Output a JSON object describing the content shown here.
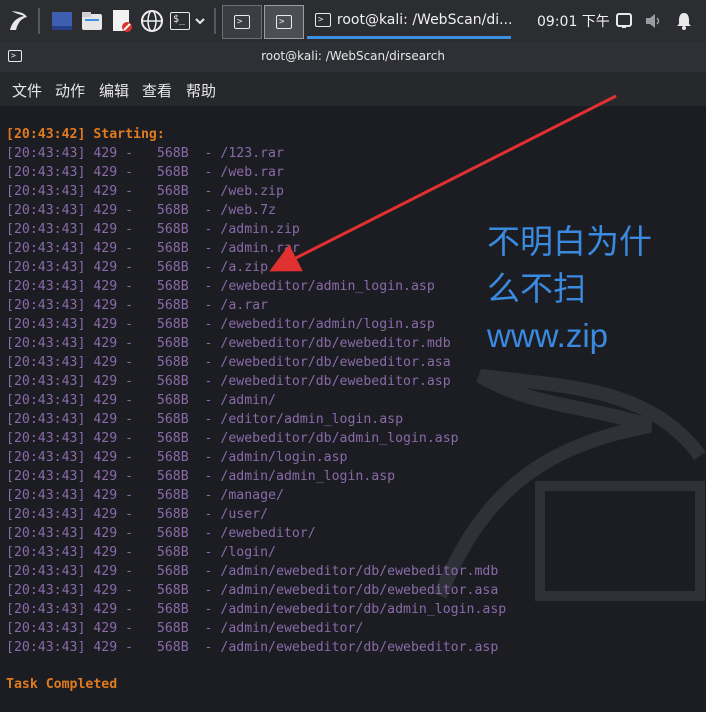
{
  "taskbar": {
    "window_title": "root@kali: /WebScan/di...",
    "clock": "09:01 下午",
    "icons": [
      "kali-dragon-icon",
      "show-desktop-icon",
      "file-manager-icon",
      "text-editor-icon",
      "web-browser-icon",
      "terminal-icon",
      "chevron-down-icon",
      "workspace-1-icon",
      "workspace-2-icon",
      "window-terminal-icon",
      "display-icon",
      "volume-icon",
      "notification-bell-icon"
    ]
  },
  "terminal": {
    "title": "root@kali: /WebScan/dirsearch",
    "menu": [
      "文件",
      "动作",
      "编辑",
      "查看",
      "帮助"
    ],
    "start_line": "[20:43:42] Starting:",
    "rows": [
      {
        "time": "[20:43:43]",
        "code": "429",
        "size": "568B",
        "path": "/123.rar"
      },
      {
        "time": "[20:43:43]",
        "code": "429",
        "size": "568B",
        "path": "/web.rar"
      },
      {
        "time": "[20:43:43]",
        "code": "429",
        "size": "568B",
        "path": "/web.zip"
      },
      {
        "time": "[20:43:43]",
        "code": "429",
        "size": "568B",
        "path": "/web.7z"
      },
      {
        "time": "[20:43:43]",
        "code": "429",
        "size": "568B",
        "path": "/admin.zip"
      },
      {
        "time": "[20:43:43]",
        "code": "429",
        "size": "568B",
        "path": "/admin.rar"
      },
      {
        "time": "[20:43:43]",
        "code": "429",
        "size": "568B",
        "path": "/a.zip"
      },
      {
        "time": "[20:43:43]",
        "code": "429",
        "size": "568B",
        "path": "/ewebeditor/admin_login.asp"
      },
      {
        "time": "[20:43:43]",
        "code": "429",
        "size": "568B",
        "path": "/a.rar"
      },
      {
        "time": "[20:43:43]",
        "code": "429",
        "size": "568B",
        "path": "/ewebeditor/admin/login.asp"
      },
      {
        "time": "[20:43:43]",
        "code": "429",
        "size": "568B",
        "path": "/ewebeditor/db/ewebeditor.mdb"
      },
      {
        "time": "[20:43:43]",
        "code": "429",
        "size": "568B",
        "path": "/ewebeditor/db/ewebeditor.asa"
      },
      {
        "time": "[20:43:43]",
        "code": "429",
        "size": "568B",
        "path": "/ewebeditor/db/ewebeditor.asp"
      },
      {
        "time": "[20:43:43]",
        "code": "429",
        "size": "568B",
        "path": "/admin/"
      },
      {
        "time": "[20:43:43]",
        "code": "429",
        "size": "568B",
        "path": "/editor/admin_login.asp"
      },
      {
        "time": "[20:43:43]",
        "code": "429",
        "size": "568B",
        "path": "/ewebeditor/db/admin_login.asp"
      },
      {
        "time": "[20:43:43]",
        "code": "429",
        "size": "568B",
        "path": "/admin/login.asp"
      },
      {
        "time": "[20:43:43]",
        "code": "429",
        "size": "568B",
        "path": "/admin/admin_login.asp"
      },
      {
        "time": "[20:43:43]",
        "code": "429",
        "size": "568B",
        "path": "/manage/"
      },
      {
        "time": "[20:43:43]",
        "code": "429",
        "size": "568B",
        "path": "/user/"
      },
      {
        "time": "[20:43:43]",
        "code": "429",
        "size": "568B",
        "path": "/ewebeditor/"
      },
      {
        "time": "[20:43:43]",
        "code": "429",
        "size": "568B",
        "path": "/login/"
      },
      {
        "time": "[20:43:43]",
        "code": "429",
        "size": "568B",
        "path": "/admin/ewebeditor/db/ewebeditor.mdb"
      },
      {
        "time": "[20:43:43]",
        "code": "429",
        "size": "568B",
        "path": "/admin/ewebeditor/db/ewebeditor.asa"
      },
      {
        "time": "[20:43:43]",
        "code": "429",
        "size": "568B",
        "path": "/admin/ewebeditor/db/admin_login.asp"
      },
      {
        "time": "[20:43:43]",
        "code": "429",
        "size": "568B",
        "path": "/admin/ewebeditor/"
      },
      {
        "time": "[20:43:43]",
        "code": "429",
        "size": "568B",
        "path": "/admin/ewebeditor/db/ewebeditor.asp"
      }
    ],
    "end_line": "Task Completed"
  },
  "annotation": {
    "lines": [
      "不明白为什",
      "么不扫",
      "www.zip"
    ]
  },
  "colors": {
    "accent": "#3a8ae0",
    "arrow": "#e03030",
    "highlight": "#e07a1f",
    "output_text": "#8a6aa8"
  }
}
